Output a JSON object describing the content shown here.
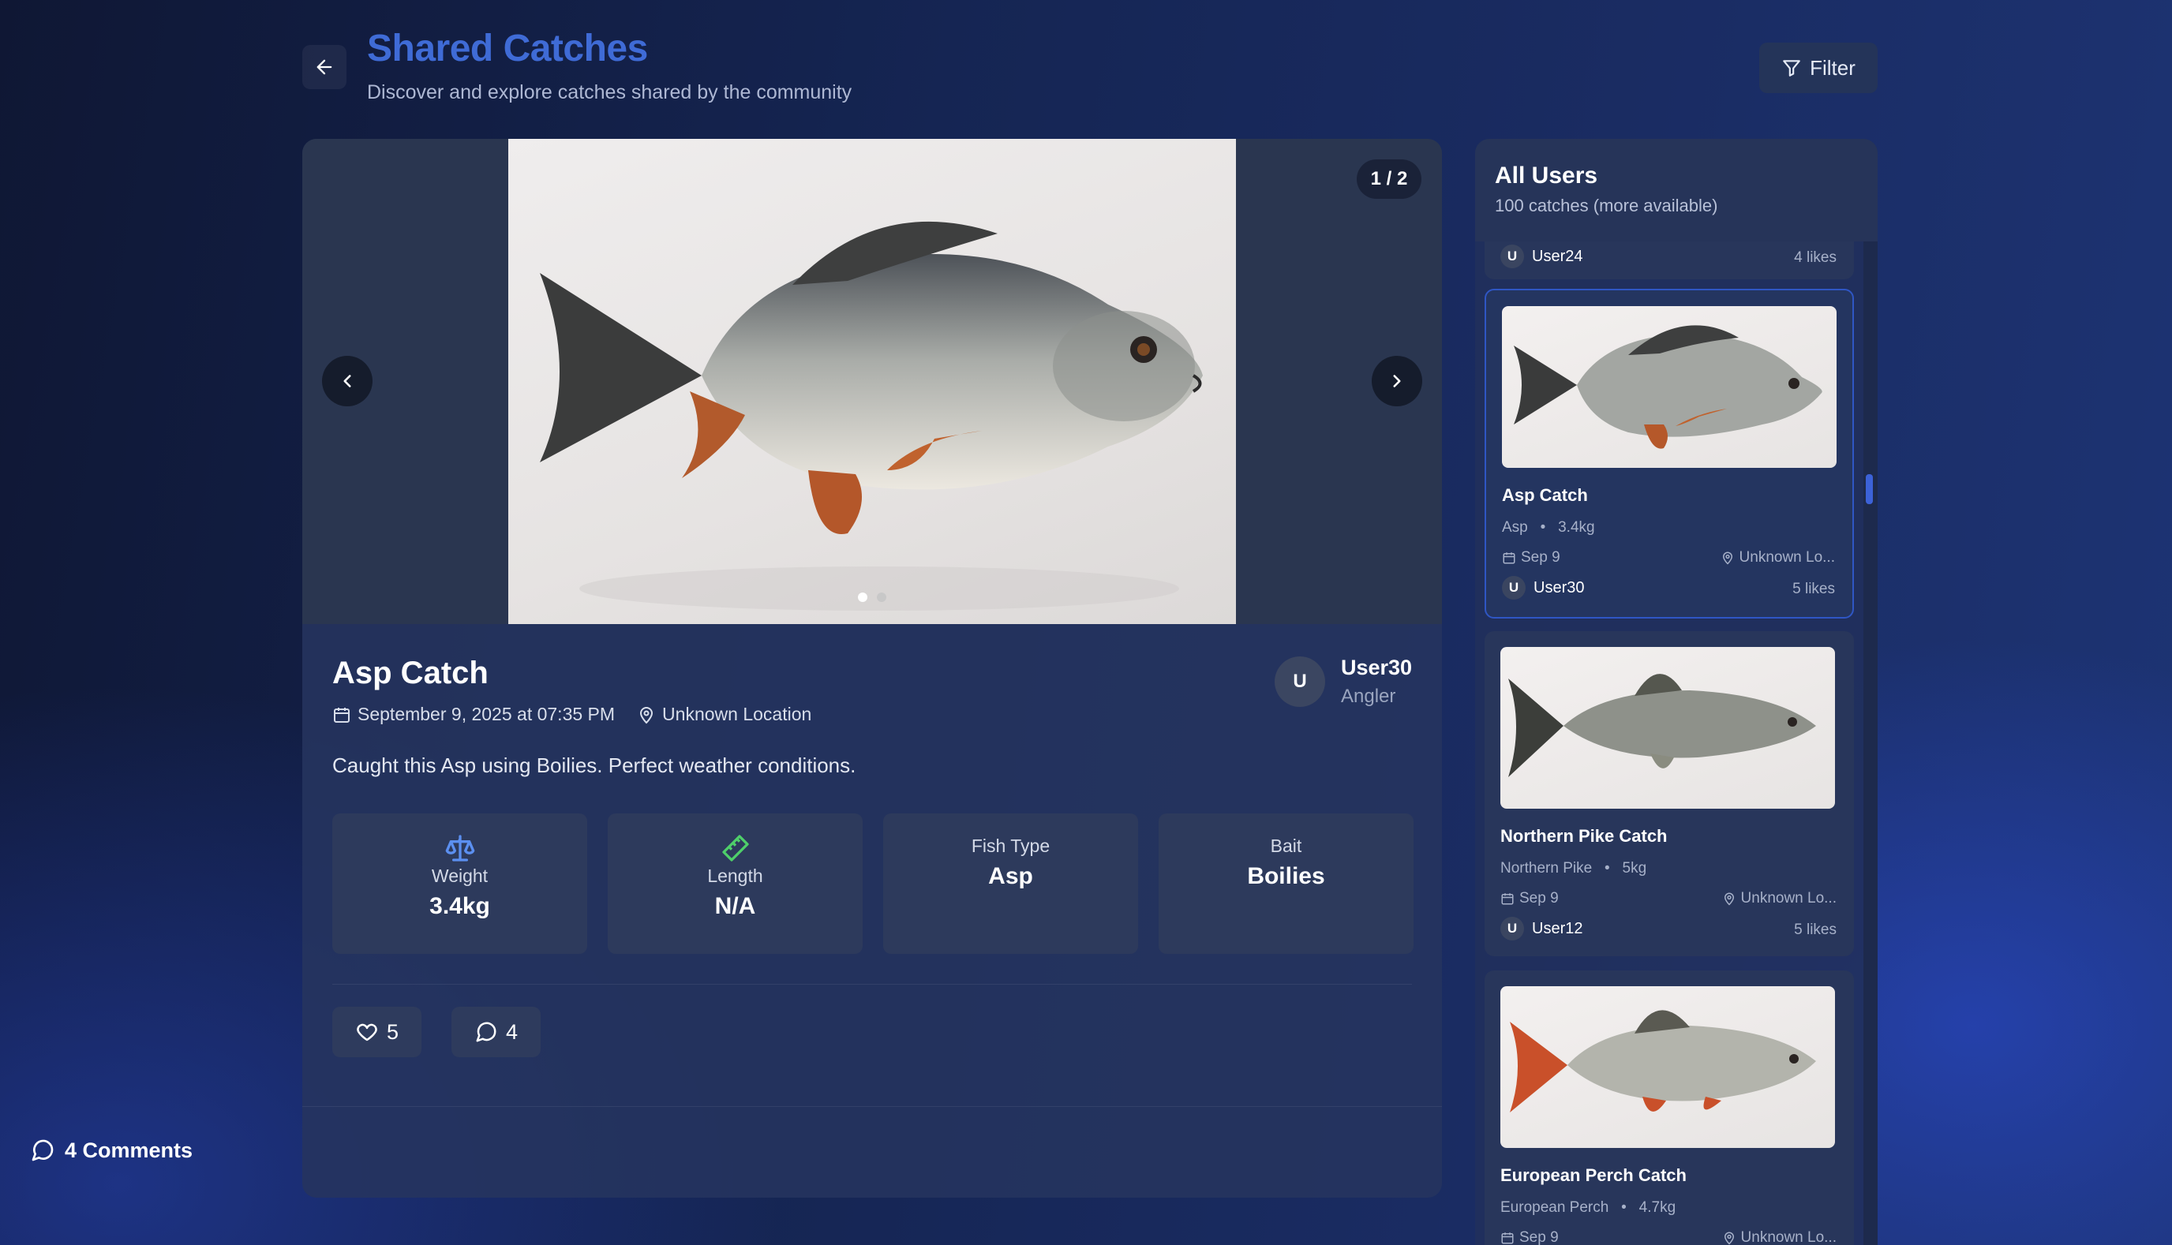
{
  "header": {
    "title": "Shared Catches",
    "subtitle": "Discover and explore catches shared by the community",
    "filter_label": "Filter"
  },
  "detail": {
    "image_counter": "1 / 2",
    "title": "Asp Catch",
    "date": "September 9, 2025 at 07:35 PM",
    "location": "Unknown Location",
    "user": {
      "initial": "U",
      "name": "User30",
      "role": "Angler"
    },
    "description": "Caught this Asp using Boilies. Perfect weather conditions.",
    "stats": [
      {
        "label": "Weight",
        "value": "3.4kg",
        "icon": "scale-icon"
      },
      {
        "label": "Length",
        "value": "N/A",
        "icon": "ruler-icon"
      },
      {
        "label": "Fish Type",
        "value": "Asp"
      },
      {
        "label": "Bait",
        "value": "Boilies"
      }
    ],
    "likes": "5",
    "comments_count": "4",
    "comments_header": "4 Comments"
  },
  "sidebar": {
    "title": "All Users",
    "subtitle": "100 catches (more available)",
    "partial_item": {
      "initial": "U",
      "user": "User24",
      "likes": "4 likes"
    },
    "items": [
      {
        "title": "Asp Catch",
        "species": "Asp",
        "weight": "3.4kg",
        "date": "Sep 9",
        "location": "Unknown Lo...",
        "initial": "U",
        "user": "User30",
        "likes": "5 likes",
        "selected": true
      },
      {
        "title": "Northern Pike Catch",
        "species": "Northern Pike",
        "weight": "5kg",
        "date": "Sep 9",
        "location": "Unknown Lo...",
        "initial": "U",
        "user": "User12",
        "likes": "5 likes"
      },
      {
        "title": "European Perch Catch",
        "species": "European Perch",
        "weight": "4.7kg",
        "date": "Sep 9",
        "location": "Unknown Lo...",
        "initial": "U",
        "user": "",
        "likes": ""
      }
    ]
  },
  "colors": {
    "accent": "#3f6bd6",
    "weight_icon": "#5b8ff0",
    "length_icon": "#4ecf6a"
  }
}
